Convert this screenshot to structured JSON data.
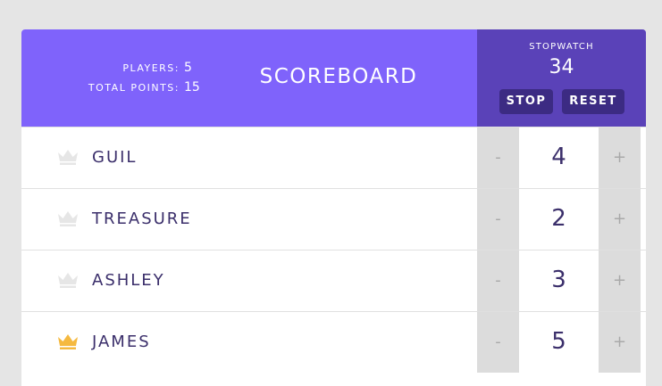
{
  "header": {
    "title": "SCOREBOARD",
    "stats": {
      "players_label": "PLAYERS:",
      "players_value": "5",
      "total_label": "TOTAL POINTS:",
      "total_value": "15"
    },
    "stopwatch": {
      "label": "STOPWATCH",
      "time": "34",
      "stop_label": "STOP",
      "reset_label": "RESET"
    }
  },
  "players": [
    {
      "name": "GUIL",
      "score": "4",
      "crown_color": "#e6e6e6",
      "decrement": "-",
      "increment": "+"
    },
    {
      "name": "TREASURE",
      "score": "2",
      "crown_color": "#e6e6e6",
      "decrement": "-",
      "increment": "+"
    },
    {
      "name": "ASHLEY",
      "score": "3",
      "crown_color": "#e6e6e6",
      "decrement": "-",
      "increment": "+"
    },
    {
      "name": "JAMES",
      "score": "5",
      "crown_color": "#f5b93f",
      "decrement": "-",
      "increment": "+"
    }
  ],
  "colors": {
    "header_bg": "#7f63fb",
    "stopwatch_bg": "#5a42b8",
    "button_bg": "#3c2b83",
    "leader_crown": "#f5b93f"
  }
}
